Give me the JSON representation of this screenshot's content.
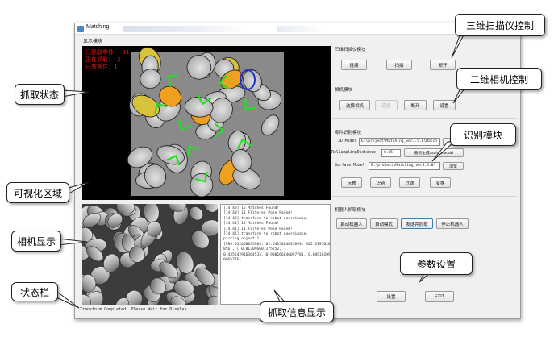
{
  "window": {
    "title": "Matching"
  },
  "display_group": {
    "label": "显示模块",
    "status_lines": [
      "已抓取零件： 11",
      "正在抓取： 2",
      "已有零件：1"
    ]
  },
  "log": {
    "lines": [
      "[14:40]:15 Matches Found!",
      "[14:40]:11 Filtered Pose Found!",
      "[14:40]:transform to robot coordinate.",
      "[14:41]:15 Matches Found!",
      "[14:41]:11 Filtered Pose Found!",
      "[14:41]:transform to robot coordinate.",
      "picking object 1",
      "[989.012468035963, 62.5415084035899, 302.3195028474",
      "856], [-0.013096601375252, -",
      "0.435242916364533, 0.900166846097781, 0.009102099",
      "0065776]"
    ]
  },
  "statusbar": {
    "text": "Transform Completed! Please Wait for Display..."
  },
  "scanner_group": {
    "label": "三维扫描仪模块",
    "buttons": [
      "连接",
      "扫描",
      "断开"
    ]
  },
  "camera_group": {
    "label": "相机模块",
    "buttons": [
      "选择相机",
      "连接",
      "断开",
      "设置"
    ]
  },
  "recognition_group": {
    "label": "零件识别模块",
    "model_label": "3D Model",
    "model_path": "E:\\project\\Matching_ver3.5.0\\Match",
    "browse1": "浏览",
    "resample_label": "RelSamplingDistance",
    "resample_value": "0.05",
    "regen_button": "重新生成SurfaceModel",
    "surface_label": "Surface Model",
    "surface_path": "E:\\project\\Matching_ver3.5.0\\",
    "browse2": "浏览",
    "buttons": [
      "示教",
      "识别",
      "过滤",
      "变换"
    ]
  },
  "robot_group": {
    "label": "机器人抓取模块",
    "buttons": [
      "启动机器人",
      "自动模式",
      "发送并抓取",
      "停止机器人"
    ]
  },
  "bottom_buttons": {
    "settings": "设置",
    "exit": "EXIT"
  },
  "callouts": {
    "scanner_control": "三维扫描仪控制",
    "camera_control": "二维相机控制",
    "recognition": "识别模块",
    "params": "参数设置",
    "pick_status": "抓取状态",
    "viz_area": "可视化区域",
    "camera_display": "相机显示",
    "status_bar": "状态栏",
    "pick_info": "抓取信息显示"
  },
  "colors": {
    "status_text": "#e01818",
    "grasp_marker": "#22e022",
    "highlight_orange": "#f0a020",
    "highlight_blue": "#2030d0"
  }
}
